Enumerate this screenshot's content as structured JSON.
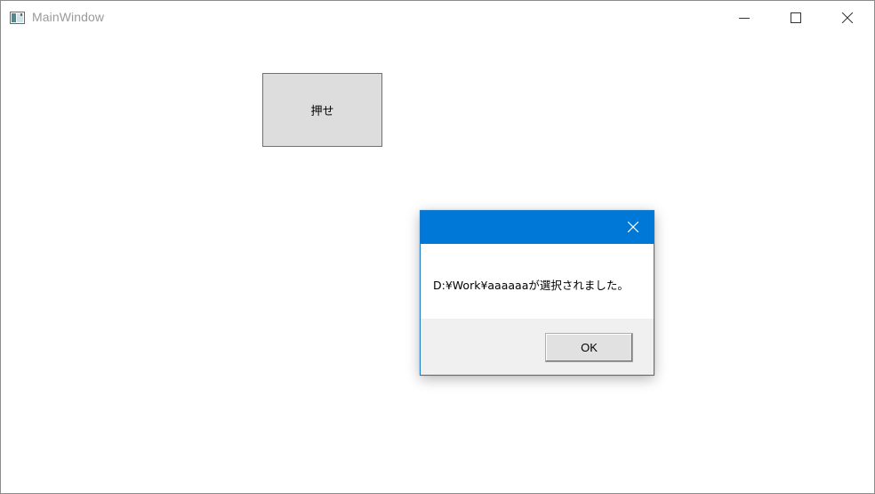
{
  "window": {
    "title": "MainWindow",
    "icon": "app-window-icon",
    "controls": [
      "minimize-icon",
      "maximize-icon",
      "close-icon"
    ]
  },
  "main": {
    "button_label": "押せ"
  },
  "dialog": {
    "accent_color": "#0078d7",
    "close_icon": "close-icon",
    "message": "D:¥Work¥aaaaaaが選択されました。",
    "ok_label": "OK"
  }
}
